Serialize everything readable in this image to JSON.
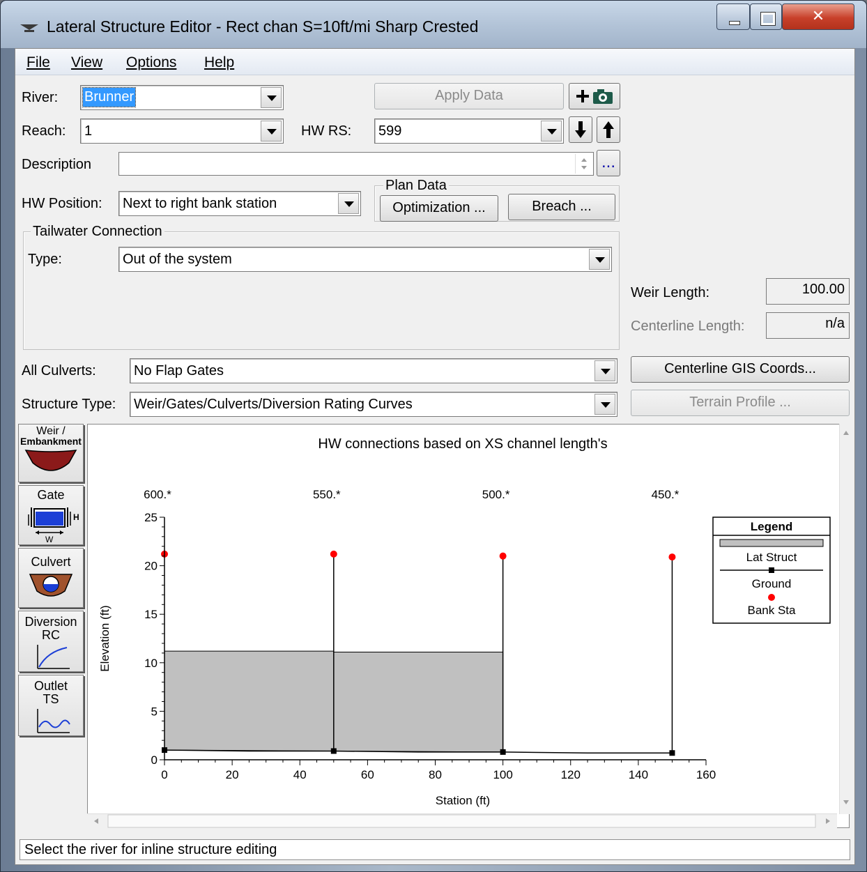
{
  "window": {
    "title": "Lateral Structure Editor - Rect chan S=10ft/mi Sharp Crested"
  },
  "menu": [
    "File",
    "View",
    "Options",
    "Help"
  ],
  "form": {
    "river_label": "River:",
    "river_value": "Brunner",
    "apply_label": "Apply Data",
    "reach_label": "Reach:",
    "reach_value": "1",
    "hwrs_label": "HW RS:",
    "hwrs_value": "599",
    "description_label": "Description",
    "description_value": "",
    "ellipsis": "...",
    "hw_position_label": "HW Position:",
    "hw_position_value": "Next to right bank station",
    "plan_data_title": "Plan Data",
    "optimization_label": "Optimization ...",
    "breach_label": "Breach ...",
    "tailwater_title": "Tailwater Connection",
    "type_label": "Type:",
    "type_value": "Out of the system",
    "weir_length_label": "Weir Length:",
    "weir_length_value": "100.00",
    "centerline_length_label": "Centerline Length:",
    "centerline_length_value": "n/a",
    "all_culverts_label": "All Culverts:",
    "all_culverts_value": "No Flap Gates",
    "centerline_gis_label": "Centerline GIS Coords...",
    "structure_type_label": "Structure Type:",
    "structure_type_value": "Weir/Gates/Culverts/Diversion Rating Curves",
    "terrain_profile_label": "Terrain Profile ..."
  },
  "side_buttons": {
    "weir": [
      "Weir /",
      "Embankment"
    ],
    "gate": "Gate",
    "gate_h": "H",
    "gate_w": "W",
    "culvert": "Culvert",
    "diversion": [
      "Diversion",
      "RC"
    ],
    "outlet": [
      "Outlet",
      "TS"
    ]
  },
  "chart_data": {
    "type": "line",
    "title": "HW connections based on XS channel length's",
    "xlabel": "Station (ft)",
    "ylabel": "Elevation (ft)",
    "xlim": [
      0,
      160
    ],
    "ylim": [
      0,
      25
    ],
    "x_ticks": [
      0,
      20,
      40,
      60,
      80,
      100,
      120,
      140,
      160
    ],
    "y_ticks": [
      0,
      5,
      10,
      15,
      20,
      25
    ],
    "xs_labels": [
      {
        "label": "600.*",
        "x": 0
      },
      {
        "label": "550.*",
        "x": 50
      },
      {
        "label": "500.*",
        "x": 100
      },
      {
        "label": "450.*",
        "x": 150
      }
    ],
    "lat_struct": {
      "x": [
        0,
        50,
        50,
        100
      ],
      "top": [
        11.2,
        11.2,
        11.1,
        11.1
      ],
      "bottom": [
        1.0,
        0.9,
        0.9,
        0.8
      ]
    },
    "ground": {
      "x": [
        0,
        25,
        50,
        75,
        100,
        125,
        150
      ],
      "y": [
        1.0,
        0.9,
        0.9,
        0.8,
        0.8,
        0.7,
        0.7
      ]
    },
    "bank_sta": {
      "x": [
        0,
        50,
        100,
        150
      ],
      "y": [
        21.2,
        21.2,
        21.0,
        20.9
      ]
    },
    "legend": {
      "title": "Legend",
      "items": [
        "Lat Struct",
        "Ground",
        "Bank Sta"
      ],
      "position": "top-right"
    },
    "colors": {
      "lat_struct": "#c0c0c0",
      "ground": "#000000",
      "bank_sta": "#ff0000"
    }
  },
  "status": "Select the river for inline structure editing"
}
